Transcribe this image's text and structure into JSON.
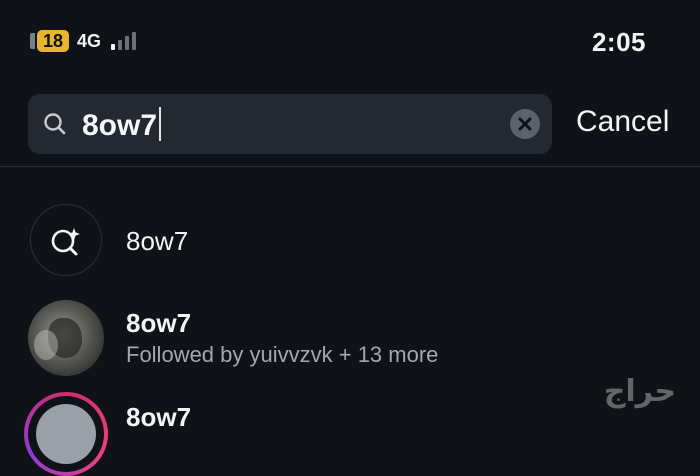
{
  "status_bar": {
    "cell_badge": "18",
    "network": "4G",
    "signal_bars_on": 1,
    "signal_bars_total": 4,
    "time": "2:05"
  },
  "search": {
    "value": "8ow7",
    "cancel_label": "Cancel"
  },
  "results": [
    {
      "type": "keyword",
      "title": "8ow7"
    },
    {
      "type": "account",
      "title": "8ow7",
      "subtitle": "Followed by yuivvzvk + 13 more"
    },
    {
      "type": "account",
      "title": "8ow7"
    }
  ],
  "watermark": "حراج",
  "icons": [
    "search-icon",
    "clear-icon",
    "keyword-search-icon",
    "avatar"
  ],
  "colors": {
    "background": "#0f1217",
    "search_field": "#232831",
    "badge": "#e7b52e",
    "story_ring": "#d12d6e"
  }
}
